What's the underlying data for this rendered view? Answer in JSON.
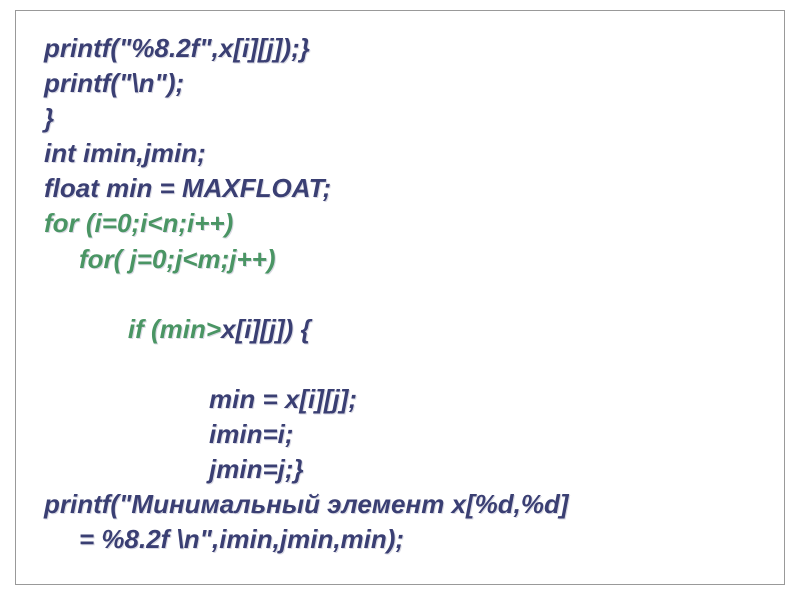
{
  "code": {
    "line1": "printf(\"%8.2f\",x[i][j]);}",
    "line2": "printf(\"\\n\");",
    "line3": "}",
    "line4": "int imin,jmin;",
    "line5": "float min = MAXFLOAT;",
    "line6": "for (i=0;i<n;i++)",
    "line7": "for( j=0;j<m;j++)",
    "line8a": "if (min>",
    "line8b": "x[i][j]) {",
    "line9": "min = x[i][j];",
    "line10": "imin=i;",
    "line11": "jmin=j;}",
    "line12": "printf(\"Минимальный элемент x[%d,%d]",
    "line13": "= %8.2f \\n\",imin,jmin,min);"
  }
}
